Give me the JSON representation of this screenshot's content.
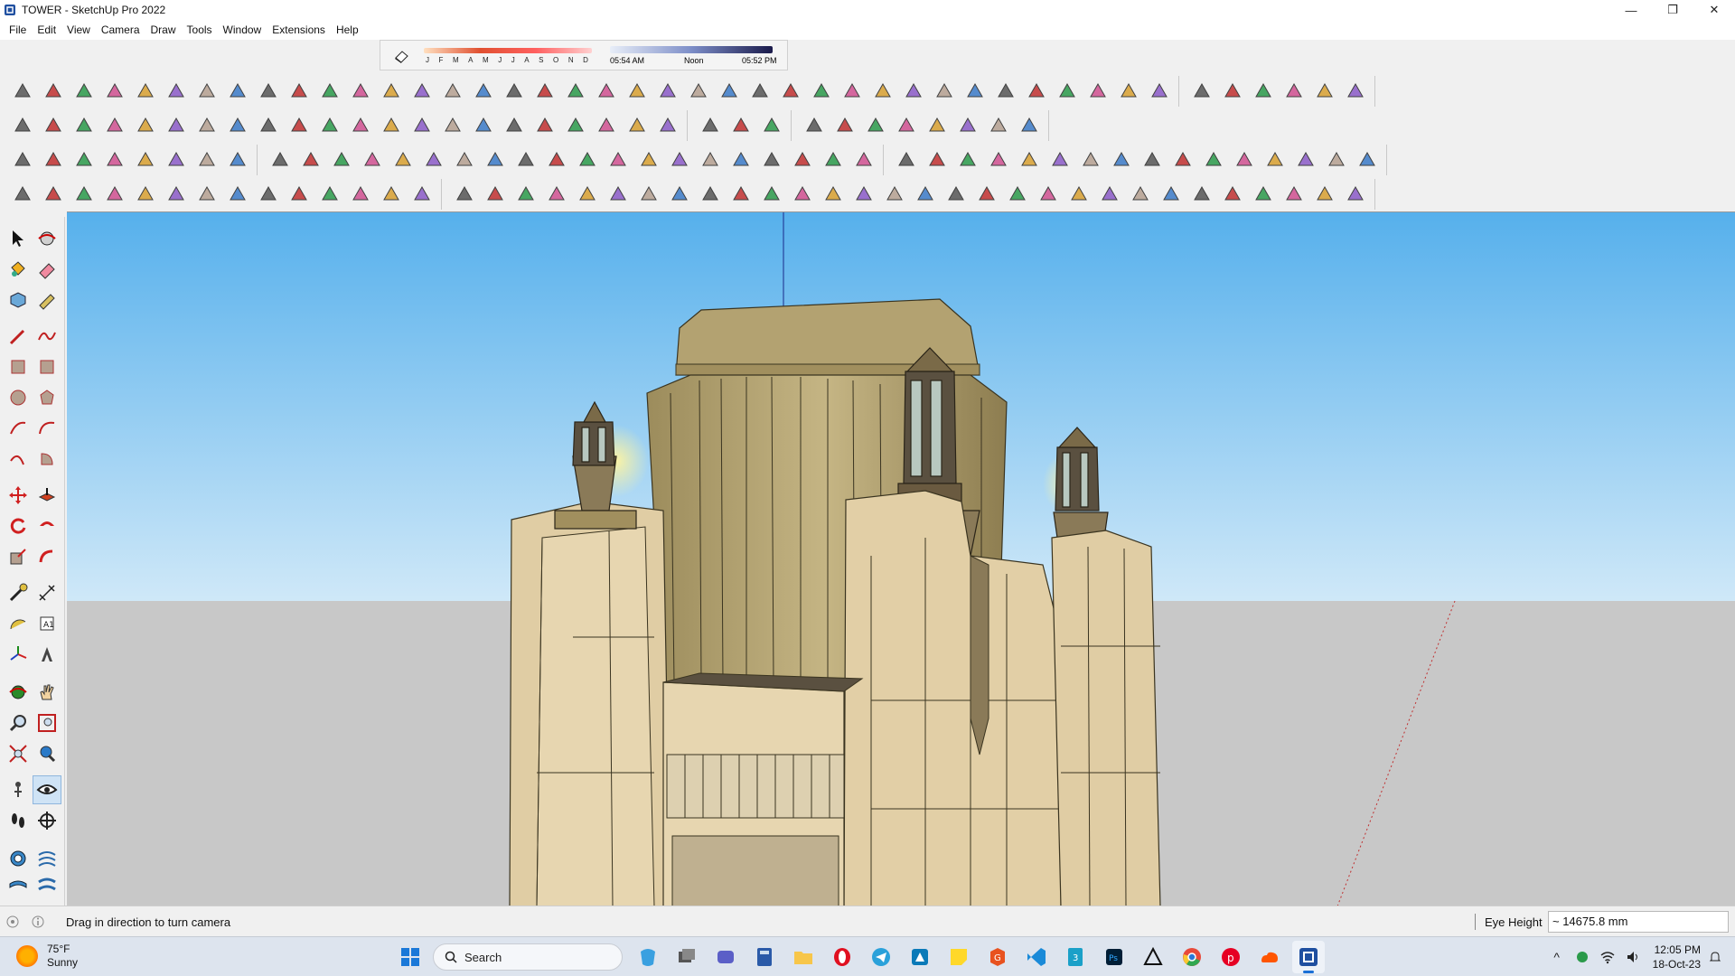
{
  "window": {
    "title": "TOWER - SketchUp Pro 2022",
    "minimize_glyph": "—",
    "restore_glyph": "❐",
    "close_glyph": "✕"
  },
  "menu": [
    "File",
    "Edit",
    "View",
    "Camera",
    "Draw",
    "Tools",
    "Window",
    "Extensions",
    "Help"
  ],
  "shadow_settings": {
    "months": [
      "J",
      "F",
      "M",
      "A",
      "M",
      "J",
      "J",
      "A",
      "S",
      "O",
      "N",
      "D"
    ],
    "time_start": "05:54 AM",
    "time_noon": "Noon",
    "time_end": "05:52 PM"
  },
  "status": {
    "hint": "Drag in direction to turn camera",
    "measurement_label": "Eye Height",
    "measurement_value": "~ 14675.8 mm"
  },
  "taskbar": {
    "weather_temp": "75°F",
    "weather_cond": "Sunny",
    "search_label": "Search",
    "time": "12:05 PM",
    "date": "18-Oct-23"
  },
  "colors": {
    "sky_top": "#56b0ec",
    "sky_bottom": "#cfe8f8",
    "ground": "#c8c8c8",
    "stone": "#e2cfa6",
    "bronze": "#b6a577"
  }
}
